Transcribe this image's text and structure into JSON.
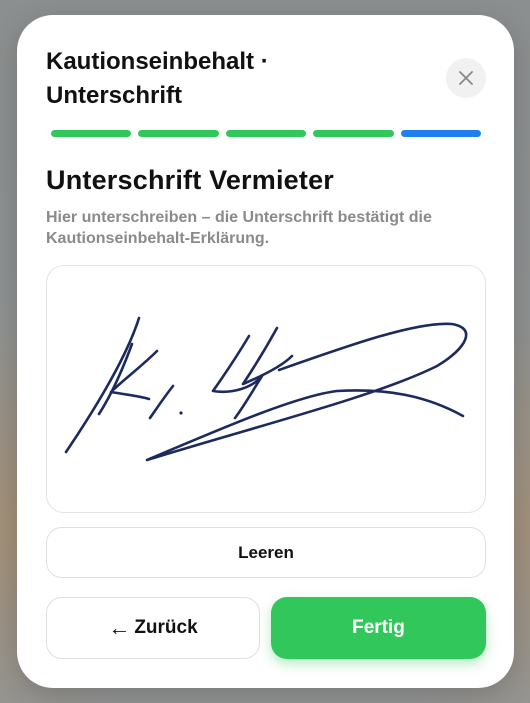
{
  "modal": {
    "title_line1": "Kautionseinbehalt ·",
    "title_line2": "Unterschrift",
    "close_icon": "close-icon"
  },
  "progress": {
    "total_steps": 5,
    "current_step": 5,
    "completed_color": "#32c75a",
    "active_color": "#1f7ff0"
  },
  "section": {
    "heading": "Unterschrift Vermieter",
    "description": "Hier unterschreiben – die Unterschrift bestätigt die Kautionseinbehalt-Erklärung."
  },
  "signature": {
    "ink_color": "#1c2a5e"
  },
  "buttons": {
    "clear_label": "Leeren",
    "back_arrow": "←",
    "back_label": "Zurück",
    "done_label": "Fertig"
  }
}
